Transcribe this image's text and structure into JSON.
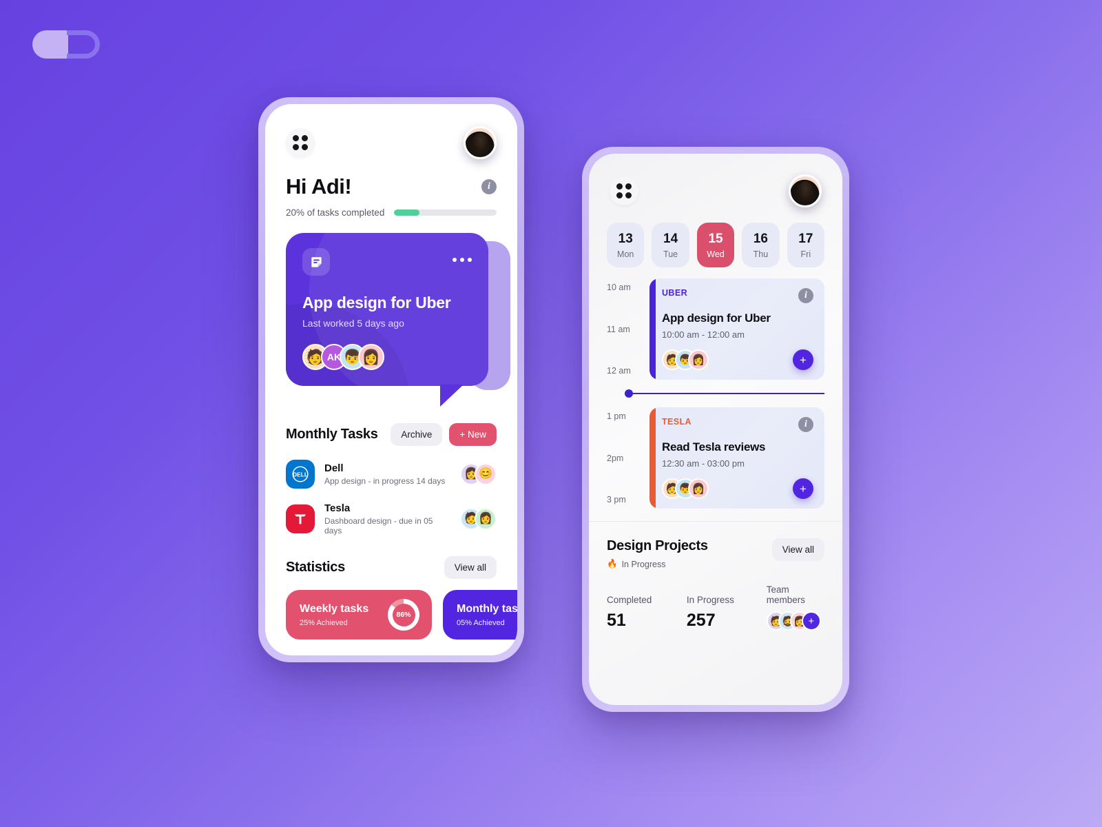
{
  "brand": {
    "logo_name": "capsule-d-logo"
  },
  "theme": {
    "background_from": "#6741e0",
    "background_to": "#bcaaf5",
    "accent_purple": "#5226e0",
    "accent_pink": "#e2526e",
    "accent_green": "#4fcf99",
    "accent_orange": "#ea5b35"
  },
  "phone_one": {
    "grid_icon": "grid-icon",
    "avatar": "user-avatar",
    "greeting": "Hi Adi!",
    "info_icon": "info-icon",
    "progress": {
      "label": "20% of tasks completed",
      "percent": 20,
      "fill_width_pct": 25
    },
    "hero": {
      "note_icon": "note-icon",
      "more_icon": "more-options-icon",
      "title": "App design for Uber",
      "subtitle": "Last worked 5 days ago",
      "members": [
        {
          "name": "member-cap-guy",
          "glyph": "🧑",
          "bg": "#fbdfc0",
          "initials": ""
        },
        {
          "name": "member-ak",
          "glyph": "",
          "bg": "#b657e0",
          "initials": "AK"
        },
        {
          "name": "member-dark-hair",
          "glyph": "👦",
          "bg": "#c3e6f5",
          "initials": ""
        },
        {
          "name": "member-beret",
          "glyph": "👩",
          "bg": "#fbc9cd",
          "initials": ""
        }
      ]
    },
    "monthly": {
      "title": "Monthly Tasks",
      "archive_label": "Archive",
      "new_label": "+ New",
      "tasks": [
        {
          "logo": "dell-logo",
          "logo_text": "D✰LL",
          "name": "Dell",
          "meta": "App design - in progress 14 days",
          "members": [
            {
              "name": "member-long-hair",
              "glyph": "👩",
              "bg": "#ddd2f6"
            },
            {
              "name": "member-wink",
              "glyph": "😊",
              "bg": "#fbd2de"
            }
          ]
        },
        {
          "logo": "tesla-logo",
          "logo_text": "T",
          "name": "Tesla",
          "meta": "Dashboard design - due in 05 days",
          "members": [
            {
              "name": "member-glasses",
              "glyph": "🧑",
              "bg": "#c9e7f7"
            },
            {
              "name": "member-bob-hair",
              "glyph": "👩",
              "bg": "#c7f0cf"
            }
          ]
        }
      ]
    },
    "statistics": {
      "title": "Statistics",
      "view_all_label": "View all",
      "cards": [
        {
          "name": "Weekly tasks",
          "sub": "25% Achieved",
          "ring_value": "86%",
          "ring_pct": 86,
          "color": "#e2526e"
        },
        {
          "name": "Monthly tasks",
          "sub": "05% Achieved",
          "ring_value": "",
          "ring_pct": 0,
          "color": "#5226e0"
        }
      ]
    }
  },
  "phone_two": {
    "grid_icon": "grid-icon",
    "avatar": "user-avatar",
    "days": [
      {
        "num": "13",
        "name": "Mon",
        "active": false
      },
      {
        "num": "14",
        "name": "Tue",
        "active": false
      },
      {
        "num": "15",
        "name": "Wed",
        "active": true
      },
      {
        "num": "16",
        "name": "Thu",
        "active": false
      },
      {
        "num": "17",
        "name": "Fri",
        "active": false
      }
    ],
    "agenda": [
      {
        "hours": [
          "10 am",
          "11 am",
          "12 am"
        ],
        "tag": "UBER",
        "title": "App design for Uber",
        "time": "10:00 am - 12:00 am",
        "stripe_color": "#4a24d6",
        "info_icon": "info-icon",
        "add_icon": "add-icon",
        "members": [
          {
            "name": "member-cap-guy",
            "glyph": "🧑",
            "bg": "#fbdfc0"
          },
          {
            "name": "member-dark-hair",
            "glyph": "👦",
            "bg": "#c3e6f5"
          },
          {
            "name": "member-beret",
            "glyph": "👩",
            "bg": "#fbc9cd"
          }
        ]
      },
      {
        "hours": [
          "1 pm",
          "2pm",
          "3 pm"
        ],
        "tag": "TESLA",
        "title": "Read Tesla reviews",
        "time": "12:30 am - 03:00 pm",
        "stripe_color": "#ea5b35",
        "info_icon": "info-icon",
        "add_icon": "add-icon",
        "members": [
          {
            "name": "member-cap-guy",
            "glyph": "🧑",
            "bg": "#fbdfc0"
          },
          {
            "name": "member-dark-hair",
            "glyph": "👦",
            "bg": "#c3e6f5"
          },
          {
            "name": "member-beret",
            "glyph": "👩",
            "bg": "#fbc9cd"
          }
        ]
      }
    ],
    "now_marker": "current-time-marker",
    "projects": {
      "title": "Design Projects",
      "status_icon": "fire-icon",
      "status_text": "In Progress",
      "view_all_label": "View all",
      "stats": [
        {
          "label": "Completed",
          "value": "51"
        },
        {
          "label": "In Progress",
          "value": "257"
        }
      ],
      "team_label": "Team members",
      "team": [
        {
          "name": "member-one",
          "glyph": "🧑",
          "bg": "#ddd2f6"
        },
        {
          "name": "member-two",
          "glyph": "🧔",
          "bg": "#c9e7f7"
        },
        {
          "name": "member-three",
          "glyph": "👩",
          "bg": "#fbd2de"
        }
      ],
      "add_label": "+"
    }
  }
}
